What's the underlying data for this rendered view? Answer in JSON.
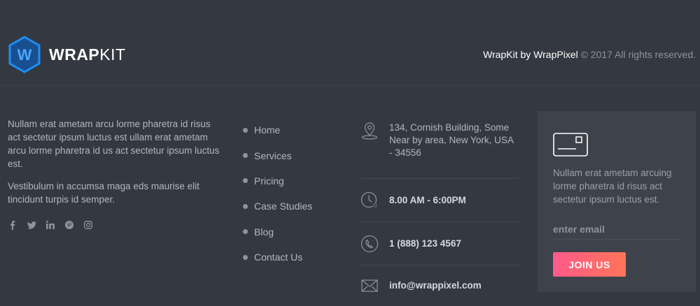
{
  "brand": {
    "logo_letter": "W",
    "name_bold": "WRAP",
    "name_light": "KIT",
    "accent": "#1d8ff5"
  },
  "copyright": {
    "brand": "WrapKit by WrapPixel",
    "text": "© 2017 All rights reserved."
  },
  "about": {
    "para1": "Nullam erat ametam arcu lorme pharetra id risus act sectetur ipsum luctus est ullam erat ametam arcu lorme pharetra id us act sectetur ipsum luctus est.",
    "para2": "Vestibulum in accumsa maga eds maurise elit tincidunt turpis id semper."
  },
  "social": [
    "facebook-icon",
    "twitter-icon",
    "linkedin-icon",
    "pinterest-icon",
    "instagram-icon"
  ],
  "links": [
    {
      "label": "Home"
    },
    {
      "label": "Services"
    },
    {
      "label": "Pricing"
    },
    {
      "label": "Case Studies"
    },
    {
      "label": "Blog"
    },
    {
      "label": "Contact Us"
    }
  ],
  "contact": {
    "address": "134, Cornish Building, Some Near by area, New York, USA - 34556",
    "hours": "8.00 AM - 6:00PM",
    "phone": "1 (888) 123 4567",
    "email": "info@wrappixel.com"
  },
  "newsletter": {
    "description": "Nullam erat ametam arcuing lorme pharetra id risus act sectetur ipsum luctus est.",
    "email_placeholder": "enter email",
    "button_label": "JOIN US",
    "button_colors": [
      "#fe5a8a",
      "#ff7459"
    ]
  }
}
